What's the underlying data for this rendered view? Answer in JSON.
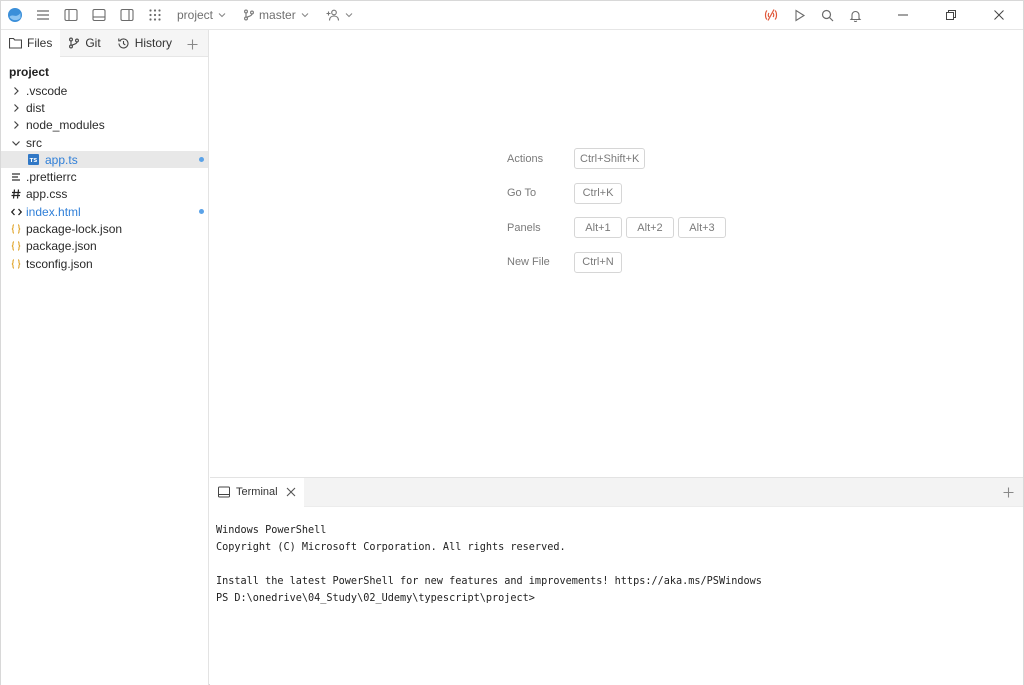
{
  "titlebar": {
    "project_label": "project",
    "branch_label": "master"
  },
  "sidebar": {
    "tabs": [
      {
        "label": "Files",
        "icon": "folder-icon"
      },
      {
        "label": "Git",
        "icon": "git-branch-icon"
      },
      {
        "label": "History",
        "icon": "history-icon"
      }
    ],
    "root": "project",
    "tree": [
      {
        "name": ".vscode",
        "type": "folder",
        "expanded": false
      },
      {
        "name": "dist",
        "type": "folder",
        "expanded": false
      },
      {
        "name": "node_modules",
        "type": "folder",
        "expanded": false
      },
      {
        "name": "src",
        "type": "folder",
        "expanded": true
      },
      {
        "name": "app.ts",
        "type": "ts",
        "icon_text": "TS",
        "modified": true,
        "selected": true
      },
      {
        "name": ".prettierrc",
        "type": "lines"
      },
      {
        "name": "app.css",
        "type": "hash"
      },
      {
        "name": "index.html",
        "type": "html",
        "modified": true
      },
      {
        "name": "package-lock.json",
        "type": "json"
      },
      {
        "name": "package.json",
        "type": "json"
      },
      {
        "name": "tsconfig.json",
        "type": "json"
      }
    ]
  },
  "shortcuts": [
    {
      "label": "Actions",
      "keys": [
        "Ctrl+Shift+K"
      ]
    },
    {
      "label": "Go To",
      "keys": [
        "Ctrl+K"
      ]
    },
    {
      "label": "Panels",
      "keys": [
        "Alt+1",
        "Alt+2",
        "Alt+3"
      ]
    },
    {
      "label": "New File",
      "keys": [
        "Ctrl+N"
      ]
    }
  ],
  "panel": {
    "tab_label": "Terminal",
    "terminal_lines": [
      "Windows PowerShell",
      "Copyright (C) Microsoft Corporation. All rights reserved.",
      "",
      "Install the latest PowerShell for new features and improvements! https://aka.ms/PSWindows",
      "PS D:\\onedrive\\04_Study\\02_Udemy\\typescript\\project>"
    ]
  },
  "colors": {
    "accent": "#2f7fd8",
    "modified_dot": "#5aa2e8",
    "broadcast_icon": "#e0573a"
  }
}
